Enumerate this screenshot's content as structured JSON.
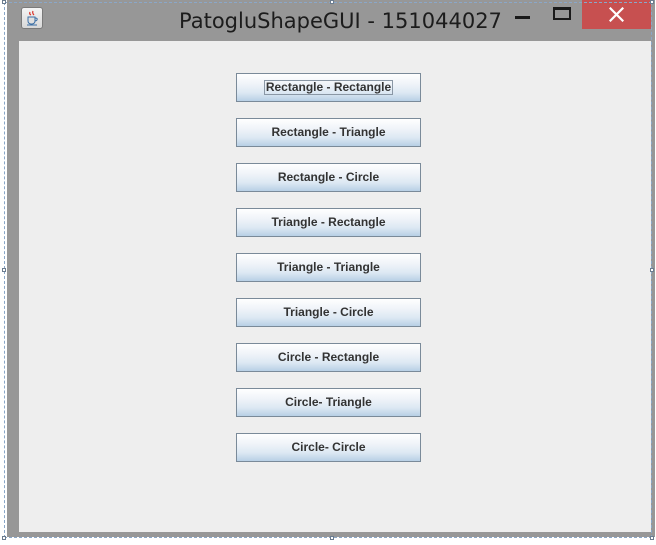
{
  "window": {
    "title": "PatogluShapeGUI - 151044027"
  },
  "buttons": [
    {
      "label": "Rectangle - Rectangle",
      "focused": true
    },
    {
      "label": "Rectangle - Triangle",
      "focused": false
    },
    {
      "label": "Rectangle - Circle",
      "focused": false
    },
    {
      "label": "Triangle - Rectangle",
      "focused": false
    },
    {
      "label": "Triangle - Triangle",
      "focused": false
    },
    {
      "label": "Triangle - Circle",
      "focused": false
    },
    {
      "label": "Circle - Rectangle",
      "focused": false
    },
    {
      "label": "Circle- Triangle",
      "focused": false
    },
    {
      "label": "Circle- Circle",
      "focused": false
    }
  ],
  "colors": {
    "titlebar": "#979797",
    "close_button": "#c75050",
    "client_background": "#eeeeee"
  },
  "icons": {
    "app": "java-cup-icon",
    "minimize": "minimize-icon",
    "maximize": "maximize-icon",
    "close": "close-icon"
  }
}
